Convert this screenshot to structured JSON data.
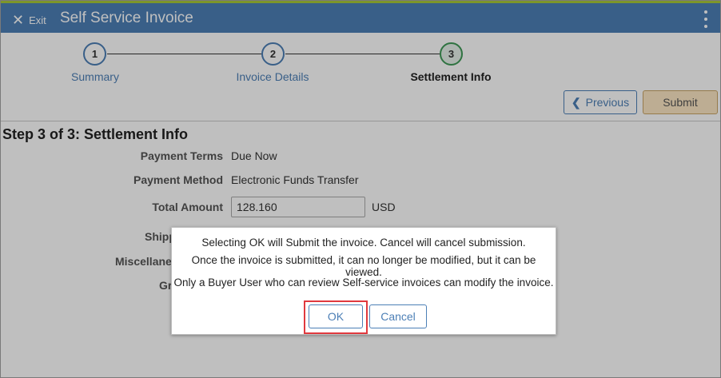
{
  "header": {
    "exit_label": "Exit",
    "title": "Self Service Invoice"
  },
  "steps": [
    {
      "number": "1",
      "label": "Summary",
      "state": "complete"
    },
    {
      "number": "2",
      "label": "Invoice Details",
      "state": "complete"
    },
    {
      "number": "3",
      "label": "Settlement Info",
      "state": "active"
    }
  ],
  "actions": {
    "previous_label": "Previous",
    "submit_label": "Submit"
  },
  "page": {
    "heading": "Step 3 of 3: Settlement Info",
    "fields": {
      "payment_terms": {
        "label": "Payment Terms",
        "value": "Due Now"
      },
      "payment_method": {
        "label": "Payment Method",
        "value": "Electronic Funds Transfer"
      },
      "total_amount": {
        "label": "Total Amount",
        "value": "128.160",
        "currency": "USD"
      },
      "shipping_fragment": "Shipp",
      "misc_fragment": "Miscellane",
      "gross_fragment": "Gr"
    }
  },
  "dialog": {
    "line1": "Selecting OK will Submit the invoice. Cancel will cancel submission.",
    "line2": "Once the invoice is submitted, it can no longer be modified, but it can be viewed.",
    "line3": "Only a Buyer User who can review Self-service invoices can modify the invoice.",
    "ok_label": "OK",
    "cancel_label": "Cancel"
  },
  "colors": {
    "header_bg": "#4c7fb6",
    "accent_strip": "#a8c93a",
    "active_step": "#3f9a57",
    "highlight": "#e0393e",
    "submit_bg": "#fde7c4"
  }
}
